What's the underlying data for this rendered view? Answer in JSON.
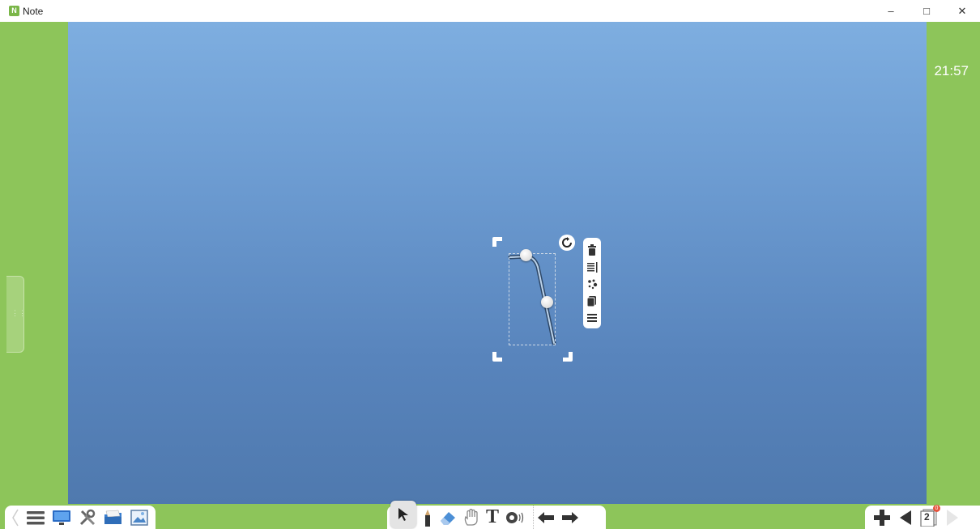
{
  "window": {
    "title": "Note",
    "app_icon_glyph": "N",
    "controls": {
      "minimize": "–",
      "maximize": "□",
      "close": "✕"
    }
  },
  "clock": {
    "time": "21:57"
  },
  "left_tab": {
    "glyph": "⋮⋮"
  },
  "colors": {
    "frame_green": "#8dc55a",
    "board_top": "#7eaee0",
    "board_bottom": "#4f79ae"
  },
  "toolbar_left": {
    "icons": [
      "prev-arrow-icon",
      "menu-icon",
      "screen-icon",
      "tools-icon",
      "open-folder-icon",
      "image-icon"
    ]
  },
  "toolbar_middle": {
    "icons": [
      "select-pointer-icon",
      "pen-icon",
      "eraser-icon",
      "hand-icon",
      "text-icon",
      "audio-icon",
      "undo-icon",
      "redo-icon"
    ],
    "text_tool_label": "T",
    "selected": "select-pointer-icon"
  },
  "toolbar_right": {
    "icons": [
      "add-page-icon",
      "prev-page-icon",
      "page-list-icon",
      "next-page-icon"
    ],
    "page_count": "2",
    "page_badge": "0"
  },
  "selection": {
    "context_menu": [
      "delete-icon",
      "align-icon",
      "color-icon",
      "copy-icon",
      "more-icon"
    ]
  }
}
